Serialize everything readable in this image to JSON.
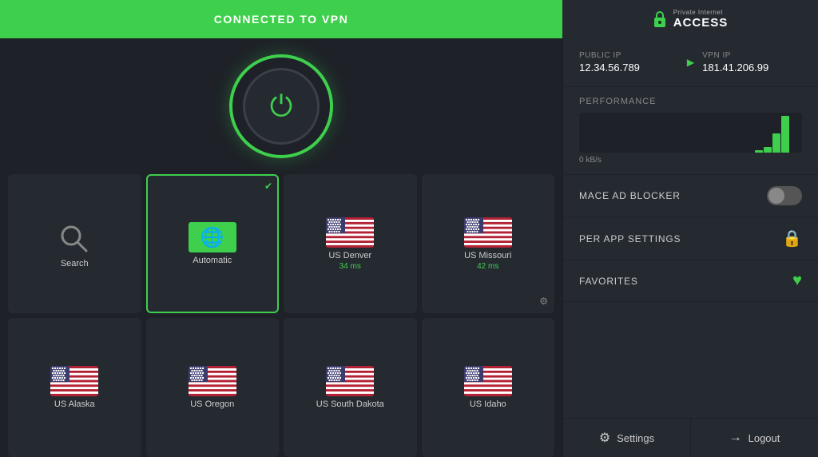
{
  "topBar": {
    "connected_label": "CONNECTED TO VPN",
    "logo_name": "Private Internet",
    "logo_brand": "ACCESS",
    "logo_sub": "Private Internet"
  },
  "ipInfo": {
    "public_label": "Public IP",
    "vpn_label": "VPN IP",
    "public_ip": "12.34.56.789",
    "vpn_ip": "181.41.206.99"
  },
  "performance": {
    "section_title": "PERFORMANCE",
    "speed": "0 kB/s",
    "bars": [
      0,
      0,
      0,
      0,
      0,
      0,
      0,
      0,
      0,
      0,
      0,
      0,
      0,
      0,
      0,
      0,
      0,
      0,
      0,
      0,
      2,
      5,
      18,
      35
    ]
  },
  "maceAdBlocker": {
    "label": "MACE AD BLOCKER"
  },
  "perAppSettings": {
    "label": "PER APP SETTINGS"
  },
  "favorites": {
    "label": "FAVORITES"
  },
  "bottomActions": {
    "settings_label": "Settings",
    "logout_label": "Logout"
  },
  "servers": [
    {
      "id": "search",
      "type": "search",
      "name": "Search",
      "ms": null
    },
    {
      "id": "automatic",
      "type": "auto",
      "name": "Automatic",
      "ms": null,
      "selected": true
    },
    {
      "id": "us-denver",
      "type": "flag",
      "name": "US Denver",
      "ms": "34 ms"
    },
    {
      "id": "us-missouri",
      "type": "flag",
      "name": "US Missouri",
      "ms": "42 ms",
      "hasSettings": true
    },
    {
      "id": "us-alaska",
      "type": "flag",
      "name": "US Alaska",
      "ms": null
    },
    {
      "id": "us-oregon",
      "type": "flag",
      "name": "US Oregon",
      "ms": null
    },
    {
      "id": "us-south-dakota",
      "type": "flag",
      "name": "US South Dakota",
      "ms": null
    },
    {
      "id": "us-idaho",
      "type": "flag",
      "name": "US Idaho",
      "ms": null
    }
  ]
}
